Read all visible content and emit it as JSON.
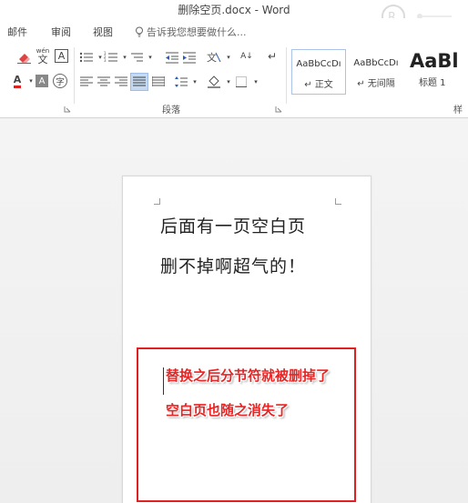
{
  "window": {
    "title": "删除空页.docx - Word"
  },
  "tabs": {
    "mail": "邮件",
    "review": "审阅",
    "view": "视图"
  },
  "tell_me": {
    "placeholder": "告诉我您想要做什么...",
    "icon": "lightbulb-icon"
  },
  "ribbon": {
    "font_group": {
      "clear_format_icon": "eraser-icon",
      "phonetic_label": "wén",
      "phonetic_char": "文",
      "char_border_label": "A",
      "font_color_label": "A",
      "char_shading_label": "A",
      "enclose_char_label": "字",
      "font_color_hex": "#e02020"
    },
    "paragraph_group": {
      "label": "段落",
      "sort_label": "A↓",
      "show_marks_label": "↵"
    },
    "styles_group": {
      "label": "样",
      "styles": [
        {
          "sample": "AaBbCcDı",
          "name": "正文",
          "mark": "↵"
        },
        {
          "sample": "AaBbCcDı",
          "name": "无间隔",
          "mark": "↵"
        },
        {
          "sample": "AaBl",
          "name": "标题 1",
          "mark": ""
        }
      ]
    }
  },
  "document": {
    "lines": [
      "后面有一页空白页",
      "删不掉啊超气的！"
    ]
  },
  "callout": {
    "lines": [
      "替换之后分节符就被删掉了",
      "空白页也随之消失了"
    ],
    "color": "#e02020"
  }
}
